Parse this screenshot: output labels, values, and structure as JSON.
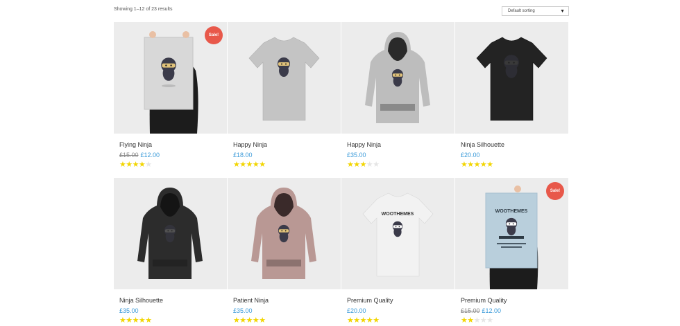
{
  "shop": {
    "result_count": "Showing 1–12 of 23 results",
    "sorting": {
      "selected": "Default sorting",
      "caret_icon": "caret-down-icon"
    },
    "sale_badge": "Sale!"
  },
  "colors": {
    "price": "#3a9ad9",
    "sale_badge": "#e8584a",
    "star_on": "#f2d500",
    "star_off": "#e5e5e5",
    "image_bg": "#ececec"
  },
  "products": [
    {
      "title": "Flying Ninja",
      "old_price": "£15.00",
      "price": "£12.00",
      "rating": 4,
      "sale": true,
      "image": "poster-ninja"
    },
    {
      "title": "Happy Ninja",
      "old_price": "",
      "price": "£18.00",
      "rating": 5,
      "sale": false,
      "image": "tshirt-grey"
    },
    {
      "title": "Happy Ninja",
      "old_price": "",
      "price": "£35.00",
      "rating": 3,
      "sale": false,
      "image": "hoodie-grey"
    },
    {
      "title": "Ninja Silhouette",
      "old_price": "",
      "price": "£20.00",
      "rating": 5,
      "sale": false,
      "image": "tshirt-black"
    },
    {
      "title": "Ninja Silhouette",
      "old_price": "",
      "price": "£35.00",
      "rating": 4.5,
      "sale": false,
      "image": "hoodie-black"
    },
    {
      "title": "Patient Ninja",
      "old_price": "",
      "price": "£35.00",
      "rating": 5,
      "sale": false,
      "image": "hoodie-pink"
    },
    {
      "title": "Premium Quality",
      "old_price": "",
      "price": "£20.00",
      "rating": 4.5,
      "sale": false,
      "image": "tshirt-white"
    },
    {
      "title": "Premium Quality",
      "old_price": "£15.00",
      "price": "£12.00",
      "rating": 2,
      "sale": true,
      "image": "poster-woothemes"
    }
  ]
}
